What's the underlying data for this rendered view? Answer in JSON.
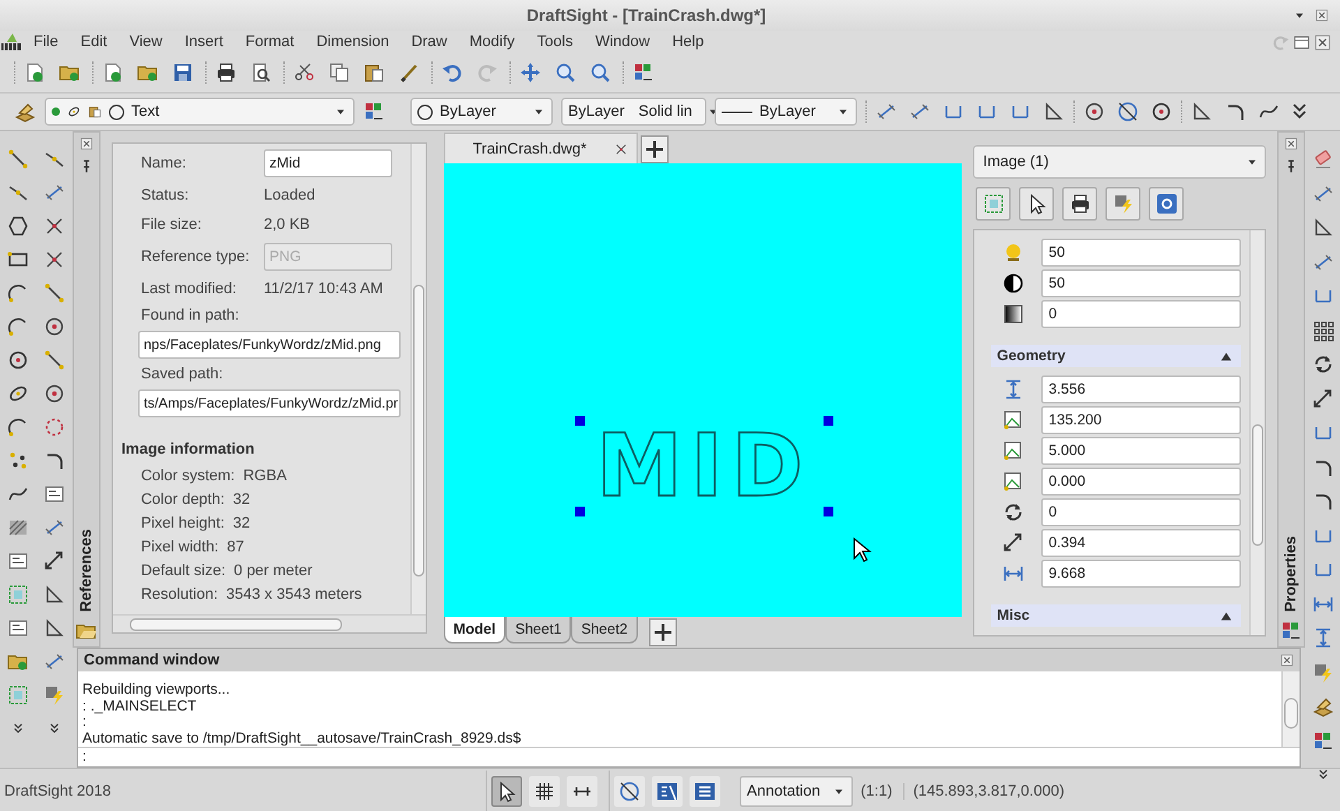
{
  "window": {
    "title": "DraftSight - [TrainCrash.dwg*]"
  },
  "menu": [
    "File",
    "Edit",
    "View",
    "Insert",
    "Format",
    "Dimension",
    "Draw",
    "Modify",
    "Tools",
    "Window",
    "Help"
  ],
  "layer_toolbar": {
    "layer": "Text",
    "color_label": "ByLayer",
    "linestyle_label": "ByLayer",
    "linestyle": "Solid lin",
    "lineweight": "ByLayer"
  },
  "references_panel": {
    "title": "References",
    "fields": [
      {
        "label": "Name:",
        "value": "zMid",
        "kind": "input"
      },
      {
        "label": "Status:",
        "value": "Loaded",
        "kind": "text"
      },
      {
        "label": "File size:",
        "value": "2,0 KB",
        "kind": "text"
      },
      {
        "label": "Reference type:",
        "value": "PNG",
        "kind": "disabled"
      },
      {
        "label": "Last modified:",
        "value": "11/2/17 10:43 AM",
        "kind": "text"
      },
      {
        "label": "Found in path:",
        "value": "nps/Faceplates/FunkyWordz/zMid.png",
        "kind": "path"
      },
      {
        "label": "Saved path:",
        "value": "ts/Amps/Faceplates/FunkyWordz/zMid.pr",
        "kind": "path"
      }
    ],
    "image_info": {
      "heading": "Image information",
      "rows": [
        {
          "label": "Color system:",
          "value": "RGBA"
        },
        {
          "label": "Color depth:",
          "value": "32"
        },
        {
          "label": "Pixel height:",
          "value": "32"
        },
        {
          "label": "Pixel width:",
          "value": "87"
        },
        {
          "label": "Default size:",
          "value": "0 per meter"
        },
        {
          "label": "Resolution:",
          "value": "3543 x 3543 meters"
        }
      ]
    }
  },
  "document_tabs": [
    {
      "label": "TrainCrash.dwg*",
      "selected": true
    }
  ],
  "drawing": {
    "image_text": "MID"
  },
  "sheet_tabs": [
    {
      "label": "Model",
      "selected": true
    },
    {
      "label": "Sheet1",
      "selected": false
    },
    {
      "label": "Sheet2",
      "selected": false
    }
  ],
  "properties_panel": {
    "title": "Properties",
    "selector": "Image (1)",
    "rows": [
      {
        "kind": "brightness",
        "value": "50"
      },
      {
        "kind": "contrast",
        "value": "50"
      },
      {
        "kind": "fade",
        "value": "0"
      }
    ],
    "sections": [
      {
        "title": "Geometry",
        "expanded": true,
        "rows": [
          {
            "kind": "height",
            "value": "3.556"
          },
          {
            "kind": "position-x",
            "value": "135.200"
          },
          {
            "kind": "position-y",
            "value": "5.000"
          },
          {
            "kind": "position-z",
            "value": "0.000"
          },
          {
            "kind": "rotation",
            "value": "0"
          },
          {
            "kind": "scale",
            "value": "0.394"
          },
          {
            "kind": "width",
            "value": "9.668"
          }
        ]
      },
      {
        "title": "Misc",
        "expanded": true
      }
    ]
  },
  "command_window": {
    "title": "Command window",
    "lines": [
      "Rebuilding viewports...",
      ": ._MAINSELECT",
      ":",
      "Automatic save to /tmp/DraftSight__autosave/TrainCrash_8929.ds$"
    ],
    "prompt": ":"
  },
  "status_bar": {
    "app": "DraftSight 2018",
    "toggles": [
      {
        "kind": "cursor",
        "on": true
      },
      {
        "kind": "grid",
        "on": false
      },
      {
        "kind": "ortho",
        "on": false
      },
      {
        "kind": "esnap",
        "on": false
      },
      {
        "kind": "etrack",
        "on": false
      },
      {
        "kind": "lineweight",
        "on": false
      }
    ],
    "annotation": "Annotation",
    "scale": "(1:1)",
    "coordinates": "(145.893,3.817,0.000)"
  }
}
